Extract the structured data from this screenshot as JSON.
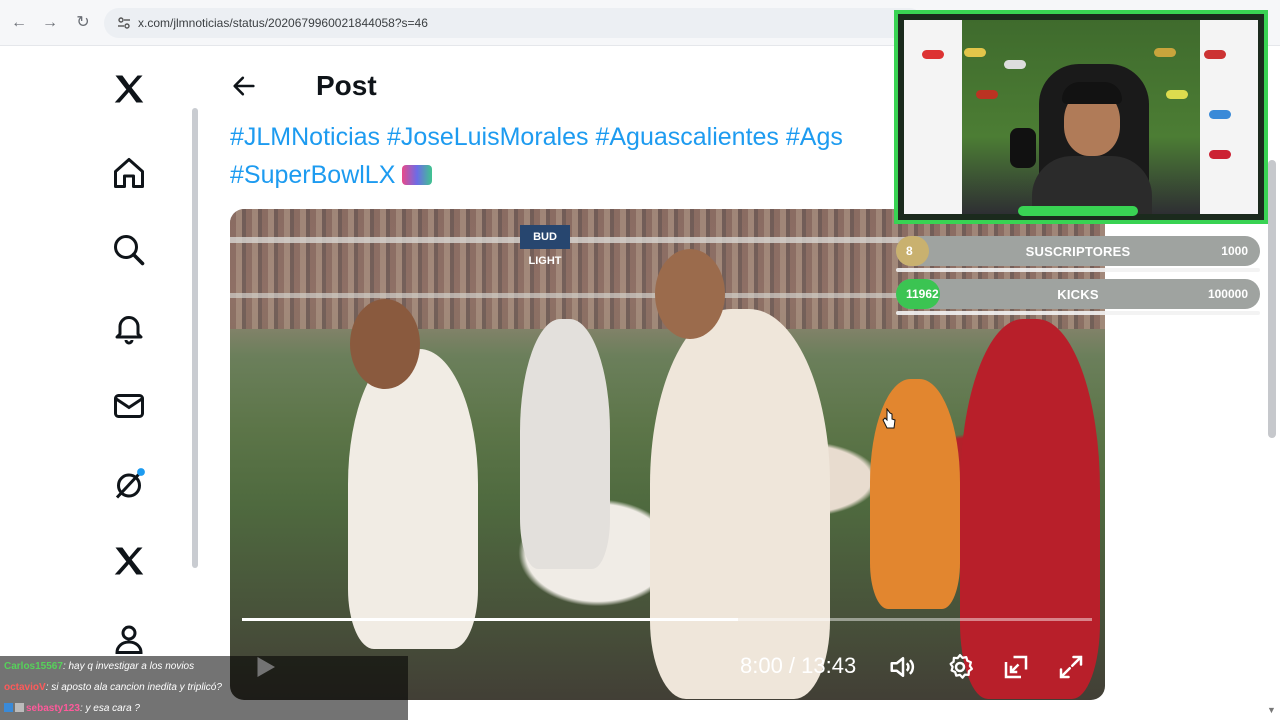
{
  "browser": {
    "url": "x.com/jlmnoticias/status/2020679960021844058?s=46"
  },
  "post": {
    "title": "Post",
    "hashtags_line1": [
      "#JLMNoticias",
      "#JoseLuisMorales",
      "#Aguascalientes",
      "#Ags"
    ],
    "hashtags_line2": [
      "#SuperBowlLX"
    ]
  },
  "video": {
    "time_display": "8:00 / 13:43",
    "progress": 0.583,
    "banner_text": "BUD LIGHT"
  },
  "stream_goals": [
    {
      "current": "8",
      "label": "SUSCRIPTORES",
      "target": "1000",
      "fill": 0.008,
      "color": "#c9b16f"
    },
    {
      "current": "11962",
      "label": "KICKS",
      "target": "100000",
      "fill": 0.12,
      "color": "#3bc452"
    }
  ],
  "chat": [
    {
      "user": "Carlos15567",
      "user_color": "#56d25a",
      "message": ": hay q investigar a los novios"
    },
    {
      "user": "octavioV",
      "user_color": "#ff5a5a",
      "message": ": si aposto ala cancion inedita y triplicó?"
    },
    {
      "user": "sebasty123",
      "user_color": "#ff5a9b",
      "message": ": y esa cara ?"
    }
  ],
  "colors": {
    "accent": "#1d9bf0",
    "kick_green": "#39d353"
  }
}
